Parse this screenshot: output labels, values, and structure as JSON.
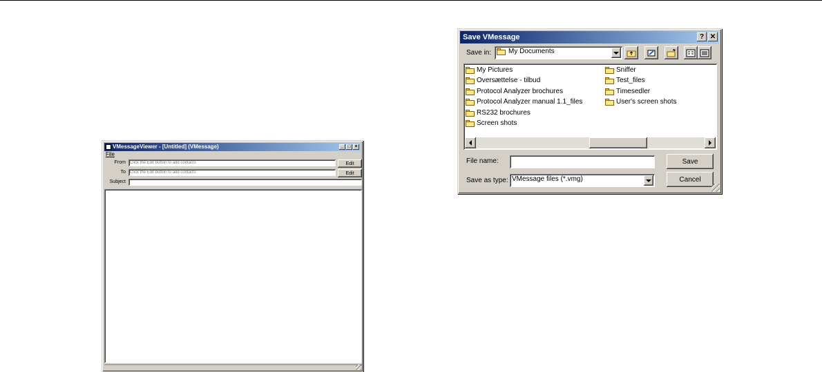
{
  "viewer": {
    "title": "VMessageViewer - [Untitled] (VMessage)",
    "menu": {
      "file": "File"
    },
    "from_label": "From",
    "to_label": "To",
    "subject_label": "Subject",
    "from_placeholder": "Click the Edit button to add contacts",
    "to_placeholder": "Click the Edit button to add contacts",
    "subject_value": "",
    "edit_label": "Edit",
    "edit2_label": "Edit"
  },
  "save_dialog": {
    "title": "Save VMessage",
    "help_glyph": "?",
    "close_glyph": "✕",
    "save_in_label": "Save in:",
    "save_in_value": "My Documents",
    "folders_col1": [
      "My Pictures",
      "Oversættelse - tilbud",
      "Protocol Analyzer brochures",
      "Protocol Analyzer manual 1.1_files",
      "RS232 brochures",
      "Screen shots"
    ],
    "folders_col2": [
      "Sniffer",
      "Test_files",
      "Timesedler",
      "User's screen shots"
    ],
    "file_name_label": "File name:",
    "file_name_value": "",
    "save_as_type_label": "Save as type:",
    "save_as_type_value": "VMessage files (*.vmg)",
    "save_button": "Save",
    "cancel_button": "Cancel"
  }
}
